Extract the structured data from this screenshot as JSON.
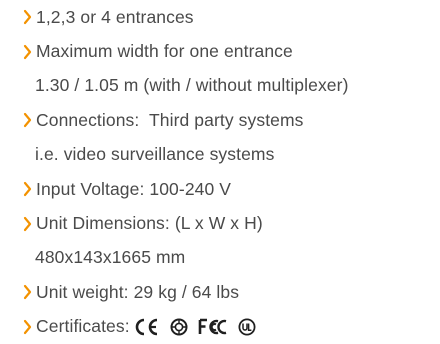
{
  "specs": [
    {
      "text": "1,2,3 or 4 entrances"
    },
    {
      "text": "Maximum width for one entrance"
    },
    {
      "text": "1.30 / 1.05 m (with / without multiplexer)"
    },
    {
      "text": "Connections:  Third party systems"
    },
    {
      "text": "i.e. video surveillance systems"
    },
    {
      "text": "Input Voltage: 100-240 V"
    },
    {
      "text": "Unit Dimensions: (L x W x H)"
    },
    {
      "text": "480x143x1665 mm"
    },
    {
      "text": "Unit weight: 29 kg / 64 lbs"
    },
    {
      "text": "Certificates:"
    }
  ],
  "icons": {
    "bullet": "chevron-right-icon",
    "certificates": [
      "ce-mark-icon",
      "weee-recycle-icon",
      "fcc-logo-icon",
      "ul-listed-icon"
    ]
  },
  "colors": {
    "bullet": "#f39200",
    "text": "#4a4a4a",
    "icons": "#1f1f1f",
    "background": "#ffffff"
  }
}
